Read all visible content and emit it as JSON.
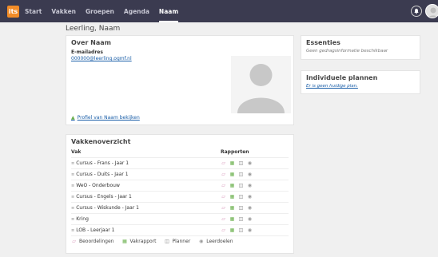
{
  "nav": {
    "logo": "its",
    "items": [
      {
        "label": "Start",
        "active": false
      },
      {
        "label": "Vakken",
        "active": false
      },
      {
        "label": "Groepen",
        "active": false
      },
      {
        "label": "Agenda",
        "active": false
      },
      {
        "label": "Naam",
        "active": true
      }
    ]
  },
  "page": {
    "title": "Leerling, Naam"
  },
  "over": {
    "title": "Over Naam",
    "email_label": "E-mailadres",
    "email": "000000@leerling.ogmf.nl",
    "profile_link": "Profiel van Naam bekijken"
  },
  "vakken": {
    "title": "Vakkenoverzicht",
    "col_vak": "Vak",
    "col_rapporten": "Rapporten",
    "rows": [
      {
        "name": "Cursus - Frans - Jaar 1"
      },
      {
        "name": "Cursus - Duits - Jaar 1"
      },
      {
        "name": "WeO - Onderbouw"
      },
      {
        "name": "Cursus - Engels - Jaar 1"
      },
      {
        "name": "Cursus - Wiskunde - Jaar 1"
      },
      {
        "name": "Kring"
      },
      {
        "name": "LOB - Leerjaar 1"
      }
    ],
    "legend": {
      "beoordelingen": "Beoordelingen",
      "vakrapport": "Vakrapport",
      "planner": "Planner",
      "leerdoelen": "Leerdoelen"
    }
  },
  "essenties": {
    "title": "Essenties",
    "empty": "Geen gedragsinformatie beschikbaar"
  },
  "individuele": {
    "title": "Individuele plannen",
    "empty_link": "Er is geen huidige plan."
  },
  "colors": {
    "nav_bg": "#3b3b50",
    "logo": "#f28c28",
    "link": "#1a5ea8",
    "accent_green": "#6ab04c"
  },
  "icons": [
    "bell-icon",
    "user-avatar-icon",
    "person-silhouette-icon",
    "folder-icon",
    "vakrapport-icon",
    "planner-icon",
    "leerdoelen-icon",
    "row-list-icon",
    "profile-user-icon"
  ]
}
